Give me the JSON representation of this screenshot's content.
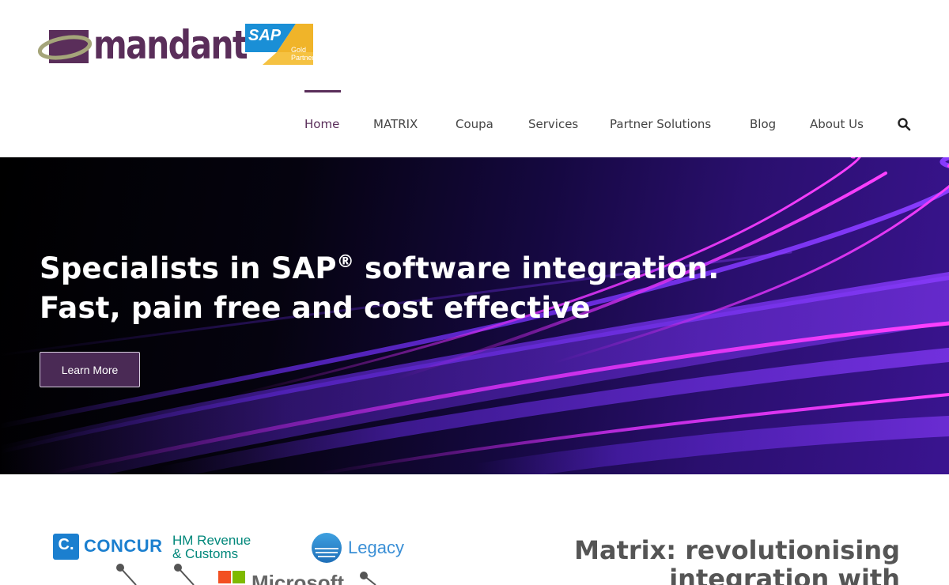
{
  "brand": {
    "logo_text": "mandant",
    "badge_brand": "SAP",
    "badge_line1": "Gold",
    "badge_line2": "Partner"
  },
  "nav": {
    "items": [
      {
        "label": "Home",
        "active": true
      },
      {
        "label": "MATRIX",
        "active": false
      },
      {
        "label": "Coupa",
        "active": false
      },
      {
        "label": "Services",
        "active": false
      },
      {
        "label": "Partner Solutions",
        "active": false
      },
      {
        "label": "Blog",
        "active": false
      },
      {
        "label": "About Us",
        "active": false
      }
    ],
    "search_icon": "search-icon"
  },
  "hero": {
    "title_line1_a": "Specialists in SAP",
    "title_line1_sup": "®",
    "title_line1_b": " software integration.",
    "title_line2": "Fast, pain free and cost effective",
    "button_label": "Learn More"
  },
  "partners": {
    "concur_mark": "C.",
    "concur": "CONCUR",
    "hmrc_line1": "HM Revenue",
    "hmrc_line2": "& Customs",
    "legacy": "Legacy",
    "microsoft": "Microsoft"
  },
  "matrix": {
    "heading_line1": "Matrix: revolutionising",
    "heading_line2": "integration with"
  },
  "colors": {
    "brand_purple": "#5a2e5a",
    "button_bg": "#4a2a55",
    "hero_streak": "#8a2be2",
    "concur_blue": "#1b7fcf",
    "hmrc_teal": "#00877a"
  }
}
